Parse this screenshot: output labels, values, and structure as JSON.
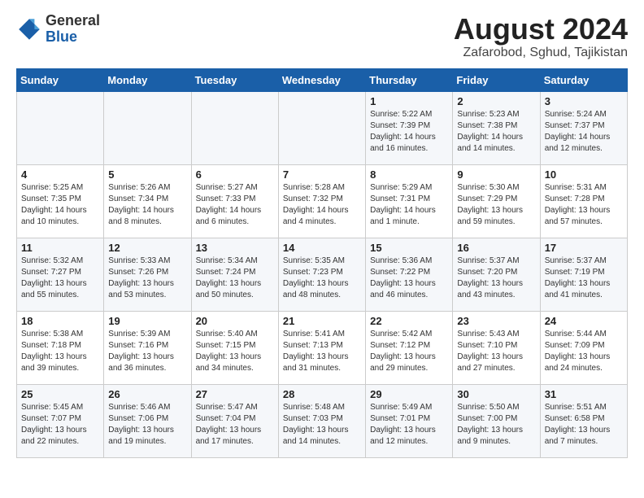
{
  "header": {
    "logo_general": "General",
    "logo_blue": "Blue",
    "title": "August 2024",
    "subtitle": "Zafarobod, Sghud, Tajikistan"
  },
  "weekdays": [
    "Sunday",
    "Monday",
    "Tuesday",
    "Wednesday",
    "Thursday",
    "Friday",
    "Saturday"
  ],
  "weeks": [
    [
      {
        "day": "",
        "info": ""
      },
      {
        "day": "",
        "info": ""
      },
      {
        "day": "",
        "info": ""
      },
      {
        "day": "",
        "info": ""
      },
      {
        "day": "1",
        "info": "Sunrise: 5:22 AM\nSunset: 7:39 PM\nDaylight: 14 hours\nand 16 minutes."
      },
      {
        "day": "2",
        "info": "Sunrise: 5:23 AM\nSunset: 7:38 PM\nDaylight: 14 hours\nand 14 minutes."
      },
      {
        "day": "3",
        "info": "Sunrise: 5:24 AM\nSunset: 7:37 PM\nDaylight: 14 hours\nand 12 minutes."
      }
    ],
    [
      {
        "day": "4",
        "info": "Sunrise: 5:25 AM\nSunset: 7:35 PM\nDaylight: 14 hours\nand 10 minutes."
      },
      {
        "day": "5",
        "info": "Sunrise: 5:26 AM\nSunset: 7:34 PM\nDaylight: 14 hours\nand 8 minutes."
      },
      {
        "day": "6",
        "info": "Sunrise: 5:27 AM\nSunset: 7:33 PM\nDaylight: 14 hours\nand 6 minutes."
      },
      {
        "day": "7",
        "info": "Sunrise: 5:28 AM\nSunset: 7:32 PM\nDaylight: 14 hours\nand 4 minutes."
      },
      {
        "day": "8",
        "info": "Sunrise: 5:29 AM\nSunset: 7:31 PM\nDaylight: 14 hours\nand 1 minute."
      },
      {
        "day": "9",
        "info": "Sunrise: 5:30 AM\nSunset: 7:29 PM\nDaylight: 13 hours\nand 59 minutes."
      },
      {
        "day": "10",
        "info": "Sunrise: 5:31 AM\nSunset: 7:28 PM\nDaylight: 13 hours\nand 57 minutes."
      }
    ],
    [
      {
        "day": "11",
        "info": "Sunrise: 5:32 AM\nSunset: 7:27 PM\nDaylight: 13 hours\nand 55 minutes."
      },
      {
        "day": "12",
        "info": "Sunrise: 5:33 AM\nSunset: 7:26 PM\nDaylight: 13 hours\nand 53 minutes."
      },
      {
        "day": "13",
        "info": "Sunrise: 5:34 AM\nSunset: 7:24 PM\nDaylight: 13 hours\nand 50 minutes."
      },
      {
        "day": "14",
        "info": "Sunrise: 5:35 AM\nSunset: 7:23 PM\nDaylight: 13 hours\nand 48 minutes."
      },
      {
        "day": "15",
        "info": "Sunrise: 5:36 AM\nSunset: 7:22 PM\nDaylight: 13 hours\nand 46 minutes."
      },
      {
        "day": "16",
        "info": "Sunrise: 5:37 AM\nSunset: 7:20 PM\nDaylight: 13 hours\nand 43 minutes."
      },
      {
        "day": "17",
        "info": "Sunrise: 5:37 AM\nSunset: 7:19 PM\nDaylight: 13 hours\nand 41 minutes."
      }
    ],
    [
      {
        "day": "18",
        "info": "Sunrise: 5:38 AM\nSunset: 7:18 PM\nDaylight: 13 hours\nand 39 minutes."
      },
      {
        "day": "19",
        "info": "Sunrise: 5:39 AM\nSunset: 7:16 PM\nDaylight: 13 hours\nand 36 minutes."
      },
      {
        "day": "20",
        "info": "Sunrise: 5:40 AM\nSunset: 7:15 PM\nDaylight: 13 hours\nand 34 minutes."
      },
      {
        "day": "21",
        "info": "Sunrise: 5:41 AM\nSunset: 7:13 PM\nDaylight: 13 hours\nand 31 minutes."
      },
      {
        "day": "22",
        "info": "Sunrise: 5:42 AM\nSunset: 7:12 PM\nDaylight: 13 hours\nand 29 minutes."
      },
      {
        "day": "23",
        "info": "Sunrise: 5:43 AM\nSunset: 7:10 PM\nDaylight: 13 hours\nand 27 minutes."
      },
      {
        "day": "24",
        "info": "Sunrise: 5:44 AM\nSunset: 7:09 PM\nDaylight: 13 hours\nand 24 minutes."
      }
    ],
    [
      {
        "day": "25",
        "info": "Sunrise: 5:45 AM\nSunset: 7:07 PM\nDaylight: 13 hours\nand 22 minutes."
      },
      {
        "day": "26",
        "info": "Sunrise: 5:46 AM\nSunset: 7:06 PM\nDaylight: 13 hours\nand 19 minutes."
      },
      {
        "day": "27",
        "info": "Sunrise: 5:47 AM\nSunset: 7:04 PM\nDaylight: 13 hours\nand 17 minutes."
      },
      {
        "day": "28",
        "info": "Sunrise: 5:48 AM\nSunset: 7:03 PM\nDaylight: 13 hours\nand 14 minutes."
      },
      {
        "day": "29",
        "info": "Sunrise: 5:49 AM\nSunset: 7:01 PM\nDaylight: 13 hours\nand 12 minutes."
      },
      {
        "day": "30",
        "info": "Sunrise: 5:50 AM\nSunset: 7:00 PM\nDaylight: 13 hours\nand 9 minutes."
      },
      {
        "day": "31",
        "info": "Sunrise: 5:51 AM\nSunset: 6:58 PM\nDaylight: 13 hours\nand 7 minutes."
      }
    ]
  ]
}
